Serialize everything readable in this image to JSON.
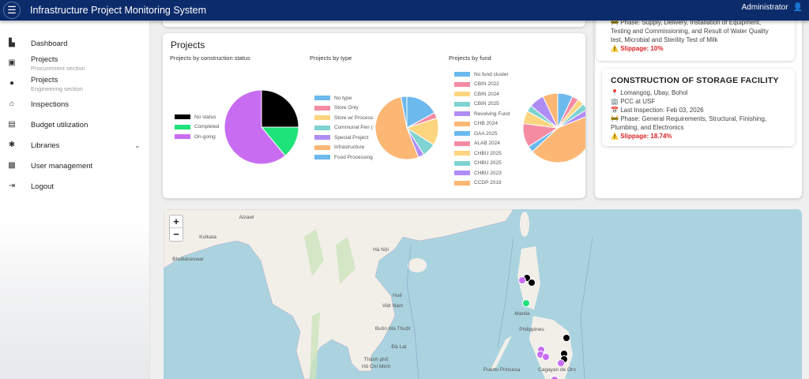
{
  "header": {
    "title": "Infrastructure Project Monitoring System",
    "user": "Administrator",
    "menu_icon": "hamburger-icon",
    "user_icon": "user-icon"
  },
  "sidebar": {
    "items": [
      {
        "label": "Dashboard",
        "icon": "dashboard-icon"
      },
      {
        "label": "Projects",
        "sub": "Procurement section",
        "icon": "bag-icon"
      },
      {
        "label": "Projects",
        "sub": "Engineering section",
        "icon": "engineer-icon"
      },
      {
        "label": "Inspections",
        "icon": "inspection-icon"
      },
      {
        "label": "Budget utilization",
        "icon": "budget-icon"
      },
      {
        "label": "Libraries",
        "icon": "gear-icon"
      },
      {
        "label": "User management",
        "icon": "user-badge-icon"
      },
      {
        "label": "Logout",
        "icon": "logout-icon"
      }
    ]
  },
  "projects_card": {
    "title": "Projects"
  },
  "chart_data": [
    {
      "type": "pie",
      "title": "Projects by construction status",
      "categories": [
        "No status",
        "Completed",
        "On-going"
      ],
      "values": [
        25,
        14,
        61
      ],
      "colors": [
        "#000000",
        "#1ee27a",
        "#c86df2"
      ]
    },
    {
      "type": "pie",
      "title": "Projects by type",
      "categories": [
        "No type",
        "Store Only",
        "Store w/ Process",
        "Communal Pen (",
        "Special Project",
        "Infrastructure",
        "Food Processing"
      ],
      "values": [
        17,
        3,
        14,
        7,
        3,
        53,
        3
      ],
      "colors": [
        "#6cb9ee",
        "#f58ba3",
        "#fdd57e",
        "#7fd3d1",
        "#b08cf5",
        "#fdb775",
        "#6cb9ee"
      ]
    },
    {
      "type": "pie",
      "title": "Projects by fund",
      "categories": [
        "No fund cluster",
        "CBIN 2022",
        "CBIN 2024",
        "CBIN 2025",
        "Revolving Fund",
        "CHB 2024",
        "GAA 2025",
        "ALAB 2024",
        "CHBU 2025",
        "CHBU 2025",
        "CHBU 2023",
        "CCDP 2019"
      ],
      "values": [
        7,
        3,
        3,
        3,
        3,
        44,
        3,
        11,
        6,
        3,
        7,
        7
      ],
      "colors": [
        "#6cb9ee",
        "#f58ba3",
        "#fdd57e",
        "#7fd3d1",
        "#b08cf5",
        "#fdb775",
        "#6cb9ee",
        "#f58ba3",
        "#fdd57e",
        "#7fd3d1",
        "#b08cf5",
        "#fdb775"
      ]
    }
  ],
  "prev_project": {
    "phase": "Phase: Supply, Delivery, Installation of Equipment, Testing and Commissioning, and Result of Water Quality test, Microbial and Sterility Test of Milk",
    "slippage": "Slippage: 10%"
  },
  "project": {
    "title": "CONSTRUCTION OF STORAGE FACILITY",
    "location": "Lomangog, Ubay, Bohol",
    "office": "PCC at USF",
    "last_inspection": "Last Inspection: Feb 03, 2026",
    "phase": "Phase: General Requirements, Structural, Finishing, Plumbing, and Electronics",
    "slippage": "Slippage: 18.74%"
  },
  "map": {
    "zoom_in": "+",
    "zoom_out": "−",
    "labels": [
      "Aizawl",
      "Kolkata",
      "Bhubaneswar",
      "Hà Nội",
      "Huế",
      "Việt Nam",
      "Buôn Ma Thuột",
      "Đà Lạt",
      "Thành phố",
      "Hồ Chí Minh",
      "Manila",
      "Philippines",
      "Puerto Princesa",
      "Cagayan de Oro"
    ],
    "marker_colors": {
      "no_status": "#000000",
      "completed": "#1ee27a",
      "on_going": "#c86df2"
    }
  }
}
